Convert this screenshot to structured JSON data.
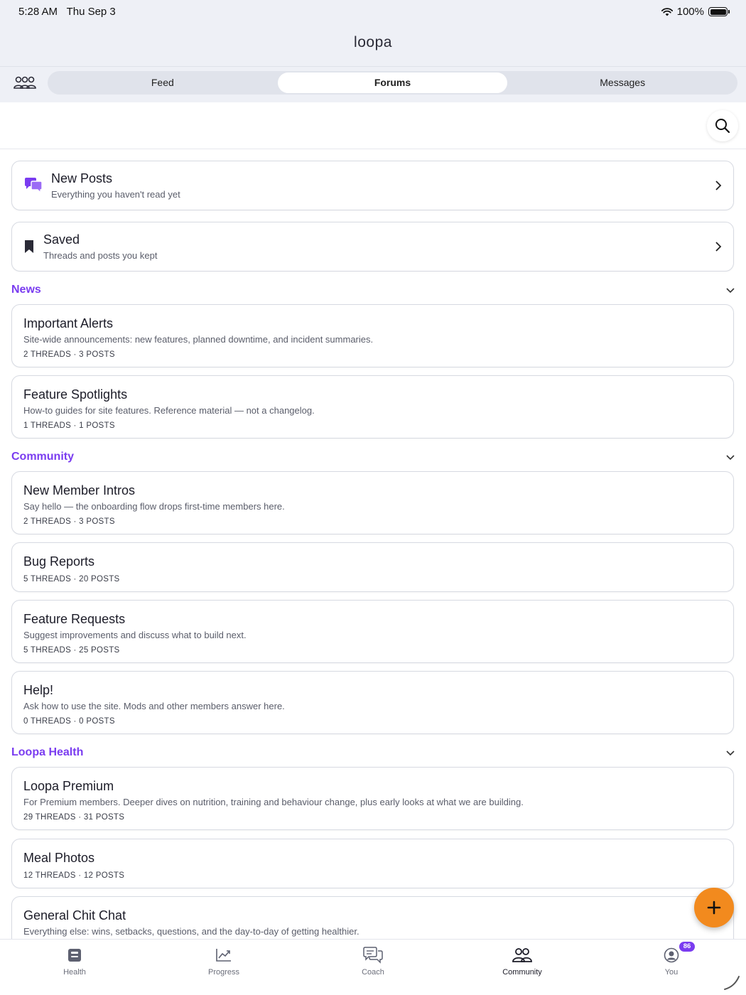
{
  "status": {
    "time": "5:28 AM",
    "date": "Thu Sep 3",
    "battery": "100%"
  },
  "app": {
    "logo": "loopa"
  },
  "tabs": [
    {
      "label": "Feed",
      "active": false
    },
    {
      "label": "Forums",
      "active": true
    },
    {
      "label": "Messages",
      "active": false
    }
  ],
  "quick_links": [
    {
      "title": "New Posts",
      "subtitle": "Everything you haven't read yet",
      "icon": "chat-bubbles-icon"
    },
    {
      "title": "Saved",
      "subtitle": "Threads and posts you kept",
      "icon": "bookmark-icon"
    }
  ],
  "sections": [
    {
      "title": "News",
      "forums": [
        {
          "title": "Important Alerts",
          "description": "Site-wide announcements: new features, planned downtime, and incident summaries.",
          "meta": "2 THREADS · 3 POSTS"
        },
        {
          "title": "Feature Spotlights",
          "description": "How-to guides for site features. Reference material — not a changelog.",
          "meta": "1 THREADS · 1 POSTS"
        }
      ]
    },
    {
      "title": "Community",
      "forums": [
        {
          "title": "New Member Intros",
          "description": "Say hello — the onboarding flow drops first-time members here.",
          "meta": "2 THREADS · 3 POSTS"
        },
        {
          "title": "Bug Reports",
          "description": "",
          "meta": "5 THREADS · 20 POSTS"
        },
        {
          "title": "Feature Requests",
          "description": "Suggest improvements and discuss what to build next.",
          "meta": "5 THREADS · 25 POSTS"
        },
        {
          "title": "Help!",
          "description": "Ask how to use the site. Mods and other members answer here.",
          "meta": "0 THREADS · 0 POSTS"
        }
      ]
    },
    {
      "title": "Loopa Health",
      "forums": [
        {
          "title": "Loopa Premium",
          "description": "For Premium members. Deeper dives on nutrition, training and behaviour change, plus early looks at what we are building.",
          "meta": "29 THREADS · 31 POSTS"
        },
        {
          "title": "Meal Photos",
          "description": "",
          "meta": "12 THREADS · 12 POSTS"
        },
        {
          "title": "General Chit Chat",
          "description": "Everything else: wins, setbacks, questions, and the day-to-day of getting healthier.",
          "meta": ""
        }
      ]
    }
  ],
  "bottom_nav": [
    {
      "label": "Health",
      "icon": "health-icon",
      "active": false
    },
    {
      "label": "Progress",
      "icon": "chart-icon",
      "active": false
    },
    {
      "label": "Coach",
      "icon": "chat-icon",
      "active": false
    },
    {
      "label": "Community",
      "icon": "community-icon",
      "active": true
    },
    {
      "label": "You",
      "icon": "profile-icon",
      "active": false,
      "badge": "86"
    }
  ],
  "colors": {
    "accent": "#7a3cf0",
    "fab": "#f28a1e",
    "background": "#eef0f6"
  }
}
